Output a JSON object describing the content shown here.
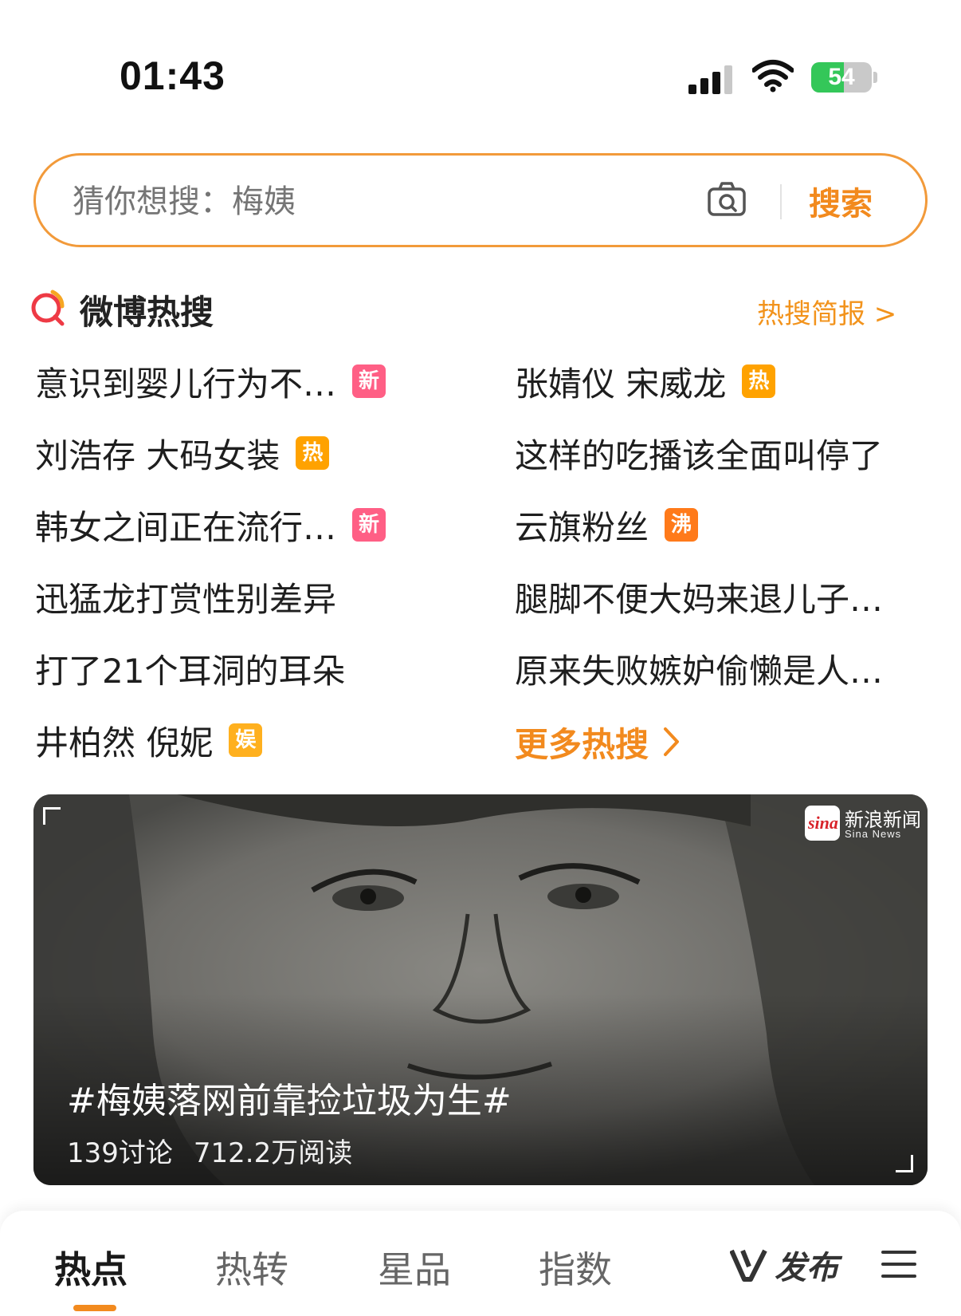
{
  "status_bar": {
    "time": "01:43",
    "battery_level": "54",
    "battery_fraction": 0.54
  },
  "search": {
    "placeholder": "猜你想搜：梅姨",
    "button_label": "搜索",
    "camera_icon": "camera-icon"
  },
  "hot_section": {
    "title": "微博热搜",
    "brief_link": "热搜简报 >",
    "more_label": "更多热搜",
    "items": [
      {
        "text": "意识到婴儿行为不…",
        "badge": "新"
      },
      {
        "text": "张婧仪 宋威龙",
        "badge": "热"
      },
      {
        "text": "刘浩存 大码女装",
        "badge": "热"
      },
      {
        "text": "这样的吃播该全面叫停了",
        "badge": ""
      },
      {
        "text": "韩女之间正在流行…",
        "badge": "新"
      },
      {
        "text": "云旗粉丝",
        "badge": "沸"
      },
      {
        "text": "迅猛龙打赏性别差异",
        "badge": ""
      },
      {
        "text": "腿脚不便大妈来退儿子…",
        "badge": ""
      },
      {
        "text": "打了21个耳洞的耳朵",
        "badge": ""
      },
      {
        "text": "原来失败嫉妒偷懒是人…",
        "badge": ""
      },
      {
        "text": "井柏然 倪妮",
        "badge": "娱"
      }
    ]
  },
  "banner": {
    "title": "#梅姨落网前靠捡垃圾为生#",
    "discussions": "139讨论",
    "reads": "712.2万阅读",
    "source_logo_text": "sina",
    "source_name": "新浪新闻",
    "source_sub": "Sina News"
  },
  "tabs": [
    {
      "label": "热点",
      "active": true
    },
    {
      "label": "热转",
      "active": false
    },
    {
      "label": "星品",
      "active": false
    },
    {
      "label": "指数",
      "active": false
    }
  ],
  "publish_label": "发布",
  "colors": {
    "accent": "#f28a1e",
    "badge_new": "#ff5f85",
    "badge_hot": "#ffa200",
    "badge_boil": "#ff7a1a",
    "badge_ent": "#ffb01e",
    "battery": "#34c759"
  }
}
